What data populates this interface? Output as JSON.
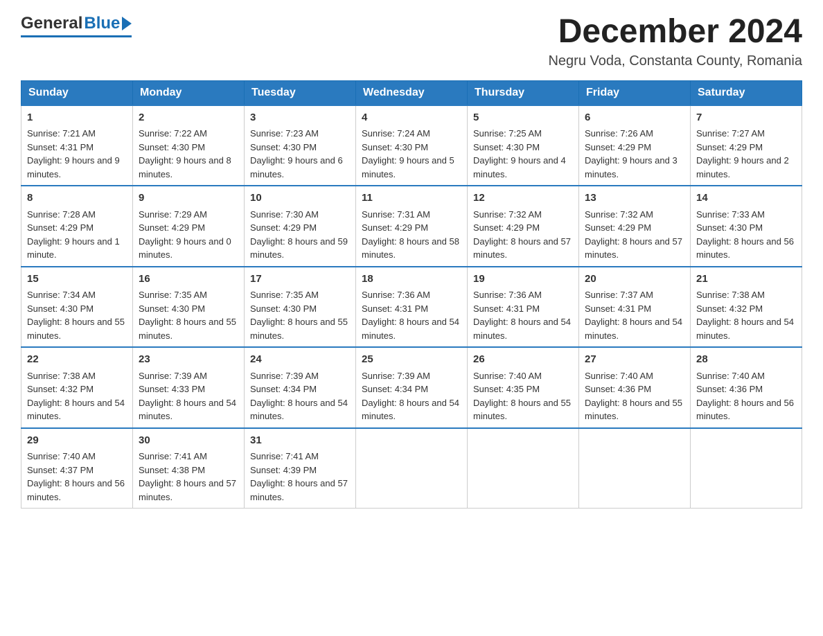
{
  "header": {
    "title": "December 2024",
    "subtitle": "Negru Voda, Constanta County, Romania",
    "logo_general": "General",
    "logo_blue": "Blue"
  },
  "calendar": {
    "days": [
      "Sunday",
      "Monday",
      "Tuesday",
      "Wednesday",
      "Thursday",
      "Friday",
      "Saturday"
    ],
    "weeks": [
      [
        {
          "day": 1,
          "sunrise": "7:21 AM",
          "sunset": "4:31 PM",
          "daylight": "9 hours and 9 minutes."
        },
        {
          "day": 2,
          "sunrise": "7:22 AM",
          "sunset": "4:30 PM",
          "daylight": "9 hours and 8 minutes."
        },
        {
          "day": 3,
          "sunrise": "7:23 AM",
          "sunset": "4:30 PM",
          "daylight": "9 hours and 6 minutes."
        },
        {
          "day": 4,
          "sunrise": "7:24 AM",
          "sunset": "4:30 PM",
          "daylight": "9 hours and 5 minutes."
        },
        {
          "day": 5,
          "sunrise": "7:25 AM",
          "sunset": "4:30 PM",
          "daylight": "9 hours and 4 minutes."
        },
        {
          "day": 6,
          "sunrise": "7:26 AM",
          "sunset": "4:29 PM",
          "daylight": "9 hours and 3 minutes."
        },
        {
          "day": 7,
          "sunrise": "7:27 AM",
          "sunset": "4:29 PM",
          "daylight": "9 hours and 2 minutes."
        }
      ],
      [
        {
          "day": 8,
          "sunrise": "7:28 AM",
          "sunset": "4:29 PM",
          "daylight": "9 hours and 1 minute."
        },
        {
          "day": 9,
          "sunrise": "7:29 AM",
          "sunset": "4:29 PM",
          "daylight": "9 hours and 0 minutes."
        },
        {
          "day": 10,
          "sunrise": "7:30 AM",
          "sunset": "4:29 PM",
          "daylight": "8 hours and 59 minutes."
        },
        {
          "day": 11,
          "sunrise": "7:31 AM",
          "sunset": "4:29 PM",
          "daylight": "8 hours and 58 minutes."
        },
        {
          "day": 12,
          "sunrise": "7:32 AM",
          "sunset": "4:29 PM",
          "daylight": "8 hours and 57 minutes."
        },
        {
          "day": 13,
          "sunrise": "7:32 AM",
          "sunset": "4:29 PM",
          "daylight": "8 hours and 57 minutes."
        },
        {
          "day": 14,
          "sunrise": "7:33 AM",
          "sunset": "4:30 PM",
          "daylight": "8 hours and 56 minutes."
        }
      ],
      [
        {
          "day": 15,
          "sunrise": "7:34 AM",
          "sunset": "4:30 PM",
          "daylight": "8 hours and 55 minutes."
        },
        {
          "day": 16,
          "sunrise": "7:35 AM",
          "sunset": "4:30 PM",
          "daylight": "8 hours and 55 minutes."
        },
        {
          "day": 17,
          "sunrise": "7:35 AM",
          "sunset": "4:30 PM",
          "daylight": "8 hours and 55 minutes."
        },
        {
          "day": 18,
          "sunrise": "7:36 AM",
          "sunset": "4:31 PM",
          "daylight": "8 hours and 54 minutes."
        },
        {
          "day": 19,
          "sunrise": "7:36 AM",
          "sunset": "4:31 PM",
          "daylight": "8 hours and 54 minutes."
        },
        {
          "day": 20,
          "sunrise": "7:37 AM",
          "sunset": "4:31 PM",
          "daylight": "8 hours and 54 minutes."
        },
        {
          "day": 21,
          "sunrise": "7:38 AM",
          "sunset": "4:32 PM",
          "daylight": "8 hours and 54 minutes."
        }
      ],
      [
        {
          "day": 22,
          "sunrise": "7:38 AM",
          "sunset": "4:32 PM",
          "daylight": "8 hours and 54 minutes."
        },
        {
          "day": 23,
          "sunrise": "7:39 AM",
          "sunset": "4:33 PM",
          "daylight": "8 hours and 54 minutes."
        },
        {
          "day": 24,
          "sunrise": "7:39 AM",
          "sunset": "4:34 PM",
          "daylight": "8 hours and 54 minutes."
        },
        {
          "day": 25,
          "sunrise": "7:39 AM",
          "sunset": "4:34 PM",
          "daylight": "8 hours and 54 minutes."
        },
        {
          "day": 26,
          "sunrise": "7:40 AM",
          "sunset": "4:35 PM",
          "daylight": "8 hours and 55 minutes."
        },
        {
          "day": 27,
          "sunrise": "7:40 AM",
          "sunset": "4:36 PM",
          "daylight": "8 hours and 55 minutes."
        },
        {
          "day": 28,
          "sunrise": "7:40 AM",
          "sunset": "4:36 PM",
          "daylight": "8 hours and 56 minutes."
        }
      ],
      [
        {
          "day": 29,
          "sunrise": "7:40 AM",
          "sunset": "4:37 PM",
          "daylight": "8 hours and 56 minutes."
        },
        {
          "day": 30,
          "sunrise": "7:41 AM",
          "sunset": "4:38 PM",
          "daylight": "8 hours and 57 minutes."
        },
        {
          "day": 31,
          "sunrise": "7:41 AM",
          "sunset": "4:39 PM",
          "daylight": "8 hours and 57 minutes."
        },
        null,
        null,
        null,
        null
      ]
    ],
    "labels": {
      "sunrise": "Sunrise:",
      "sunset": "Sunset:",
      "daylight": "Daylight:"
    }
  }
}
